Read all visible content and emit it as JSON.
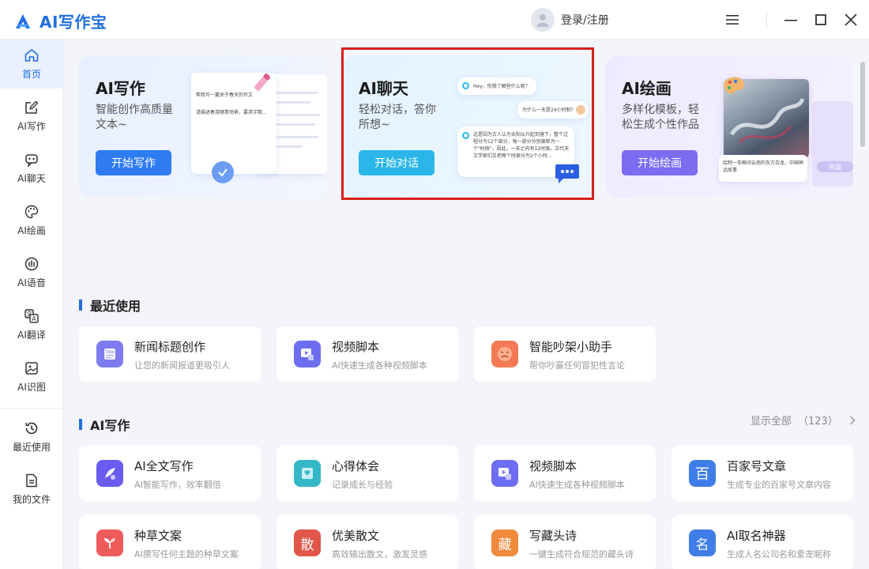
{
  "app": {
    "name": "AI写作宝"
  },
  "header": {
    "login_label": "登录/注册"
  },
  "sidebar": {
    "items": [
      {
        "label": "首页",
        "icon": "home-icon",
        "active": true
      },
      {
        "label": "AI写作",
        "icon": "pen-square-icon"
      },
      {
        "label": "AI聊天",
        "icon": "robot-chat-icon"
      },
      {
        "label": "AI绘画",
        "icon": "palette-icon"
      },
      {
        "label": "AI语音",
        "icon": "voice-icon"
      },
      {
        "label": "AI翻译",
        "icon": "translate-icon"
      },
      {
        "label": "AI识图",
        "icon": "image-scan-icon"
      },
      {
        "label": "最近使用",
        "icon": "history-icon"
      },
      {
        "label": "我的文件",
        "icon": "file-icon"
      }
    ]
  },
  "hero": {
    "write": {
      "title": "AI写作",
      "desc": "智能创作高质量文本~",
      "button": "开始写作",
      "mock_prompt": "帮我写一篇关于春天的作文",
      "mock_content": "请描述春游踏青场景，要求字数..."
    },
    "chat": {
      "title": "AI聊天",
      "desc": "轻松对话，答你所想~",
      "button": "开始对话",
      "bubble1": "Hey，你想了解些什么呢？",
      "bubble2": "为什么一天是24小时制?",
      "bubble3": "这是因为古人认为太阳从升起到落下，整个过程分为12个部分，每一部分分别被称为一个\"时辰\"，因此，一天之内有12时辰。古代天文学家们又把每个时辰分为2个小时..."
    },
    "paint": {
      "title": "AI绘画",
      "desc": "多样化模板，轻松生成个性作品",
      "button": "开始绘画",
      "caption": "绘制一条瞬间云南的东方白龙，中国神话故事",
      "done_label": "完成"
    }
  },
  "recent": {
    "title": "最近使用",
    "items": [
      {
        "title": "新闻标题创作",
        "desc": "让您的新闻报道更吸引人",
        "icon": "news-title-icon",
        "color": "#7c7cf0"
      },
      {
        "title": "视频脚本",
        "desc": "AI快速生成各种视频脚本",
        "icon": "video-script-icon",
        "color": "#6d6df2"
      },
      {
        "title": "智能吵架小助手",
        "desc": "帮你吵赢任何冒犯性言论",
        "icon": "angry-face-icon",
        "color": "#f47a55"
      }
    ]
  },
  "aiwrite": {
    "title": "AI写作",
    "show_all": "显示全部",
    "count": "（123）",
    "items": [
      {
        "title": "AI全文写作",
        "desc": "AI智能写作，效率翻倍",
        "icon": "quill-icon",
        "color": "#6a5cf0"
      },
      {
        "title": "心得体会",
        "desc": "记录成长与经验",
        "icon": "notebook-icon",
        "color": "#34b8c8"
      },
      {
        "title": "视频脚本",
        "desc": "AI快速生成各种视频脚本",
        "icon": "video-script-icon",
        "color": "#6d6df2"
      },
      {
        "title": "百家号文章",
        "desc": "生成专业的百家号文章内容",
        "icon": "baijia-icon",
        "color": "#3f7de8",
        "glyph": "百"
      },
      {
        "title": "种草文案",
        "desc": "AI撰写任何主题的种草文案",
        "icon": "sprout-icon",
        "color": "#ef5a5a"
      },
      {
        "title": "优美散文",
        "desc": "高效输出散文，激发灵感",
        "icon": "prose-book-icon",
        "color": "#e2554a",
        "glyph": "散"
      },
      {
        "title": "写藏头诗",
        "desc": "一键生成符合规范的藏头诗",
        "icon": "poem-icon",
        "color": "#f08a3c",
        "glyph": "藏"
      },
      {
        "title": "AI取名神器",
        "desc": "生成人名公司名和爱宠昵称",
        "icon": "naming-icon",
        "color": "#3f7de8",
        "glyph": "名"
      }
    ]
  }
}
